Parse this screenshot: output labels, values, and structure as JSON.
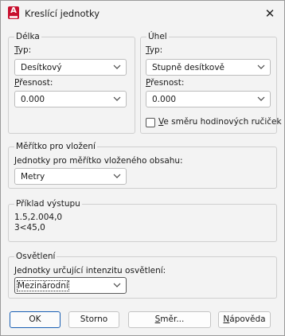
{
  "window": {
    "title": "Kreslící jednotky",
    "app_icon_letter": "A"
  },
  "length": {
    "legend": "Délka",
    "type_label_u": "T",
    "type_label_rest": "yp:",
    "type_value": "Desítkový",
    "precision_label_u": "P",
    "precision_label_rest": "řesnost:",
    "precision_value": "0.000"
  },
  "angle": {
    "legend": "Úhel",
    "type_label_u": "T",
    "type_label_rest": "yp:",
    "type_value": "Stupně desítkově",
    "precision_label_u": "P",
    "precision_label_rest": "řesnost:",
    "precision_value": "0.000",
    "clockwise_label_u": "V",
    "clockwise_label_rest": "e směru hodinových ručiček",
    "clockwise_checked": false
  },
  "insertion_scale": {
    "legend": "Měřítko pro vložení",
    "label": "Jednotky pro měřítko vloženého obsahu:",
    "value": "Metry"
  },
  "sample_output": {
    "legend": "Příklad výstupu",
    "line1": "1.5,2.004,0",
    "line2": "3<45,0"
  },
  "lighting": {
    "legend": "Osvětlení",
    "label": "Jednotky určující intenzitu osvětlení:",
    "value": "Mezinárodní"
  },
  "buttons": {
    "ok": "OK",
    "cancel": "Storno",
    "direction_u": "S",
    "direction_rest": "měr...",
    "help_u": "N",
    "help_rest": "ápověda"
  },
  "icons": {
    "app": "autocad-app-icon",
    "close": "close-icon",
    "dropdown": "chevron-down-icon"
  }
}
